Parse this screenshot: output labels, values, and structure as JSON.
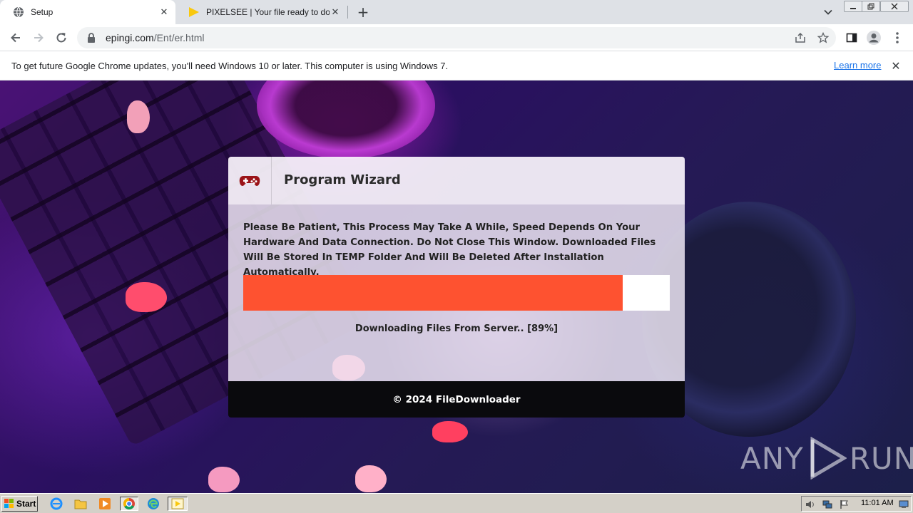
{
  "browser": {
    "tabs": [
      {
        "title": "Setup",
        "favicon": "globe-icon",
        "active": true
      },
      {
        "title": "PIXELSEE | Your file ready to downlo",
        "favicon": "play-triangle-icon",
        "active": false
      }
    ],
    "url_host": "epingi.com",
    "url_path": "/Ent/er.html"
  },
  "infobar": {
    "message": "To get future Google Chrome updates, you'll need Windows 10 or later. This computer is using Windows 7.",
    "link": "Learn more"
  },
  "wizard": {
    "title": "Program Wizard",
    "icon": "gamepad-icon",
    "description": "Please Be Patient, This Process May Take A While, Speed Depends On Your Hardware And Data Connection. Do Not Close This Window. Downloaded Files Will Be Stored In TEMP Folder And Will Be Deleted After Installation Automatically.",
    "progress_percent": 89,
    "status": "Downloading Files From Server.. [89%]",
    "footer": "© 2024 FileDownloader",
    "progress_color": "#fe5230"
  },
  "watermark": {
    "left": "ANY",
    "right": "RUN"
  },
  "taskbar": {
    "start_label": "Start",
    "clock": "11:01 AM"
  }
}
